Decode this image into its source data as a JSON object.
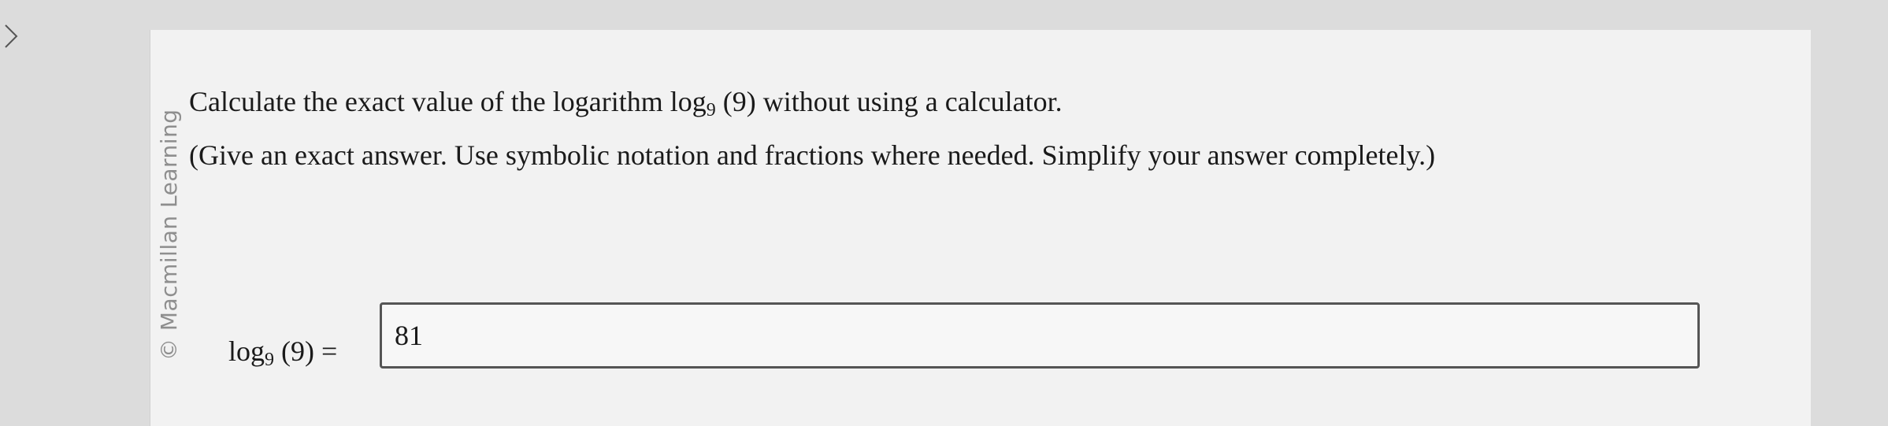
{
  "question": {
    "prefix": "Calculate the exact value of the logarithm log",
    "base": "9",
    "argument": " (9)",
    "suffix": " without using a calculator."
  },
  "instruction": "(Give an exact answer. Use symbolic notation and fractions where needed. Simplify your answer completely.)",
  "answer": {
    "label_log": "log",
    "label_base": "9",
    "label_rest": " (9) =",
    "value": "81"
  },
  "watermark": "© Macmillan Learning"
}
